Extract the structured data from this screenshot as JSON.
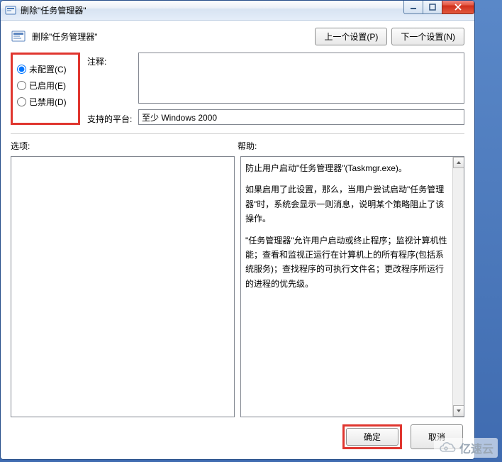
{
  "window": {
    "title": "删除\"任务管理器\""
  },
  "header": {
    "text": "删除\"任务管理器\"",
    "prev_button": "上一个设置(P)",
    "next_button": "下一个设置(N)"
  },
  "radios": {
    "not_configured": "未配置(C)",
    "enabled": "已启用(E)",
    "disabled": "已禁用(D)",
    "selected": "not_configured"
  },
  "fields": {
    "comment_label": "注释:",
    "comment_value": "",
    "platform_label": "支持的平台:",
    "platform_value": "至少 Windows 2000"
  },
  "columns": {
    "options_label": "选项:",
    "help_label": "帮助:"
  },
  "help": {
    "p1": "防止用户启动\"任务管理器\"(Taskmgr.exe)。",
    "p2": "如果启用了此设置，那么，当用户尝试启动\"任务管理器\"时，系统会显示一则消息，说明某个策略阻止了该操作。",
    "p3": "\"任务管理器\"允许用户启动或终止程序；监视计算机性能；查看和监视正运行在计算机上的所有程序(包括系统服务)；查找程序的可执行文件名；更改程序所运行的进程的优先级。"
  },
  "footer": {
    "ok": "确定",
    "cancel": "取消"
  },
  "watermark": {
    "text": "亿速云"
  }
}
